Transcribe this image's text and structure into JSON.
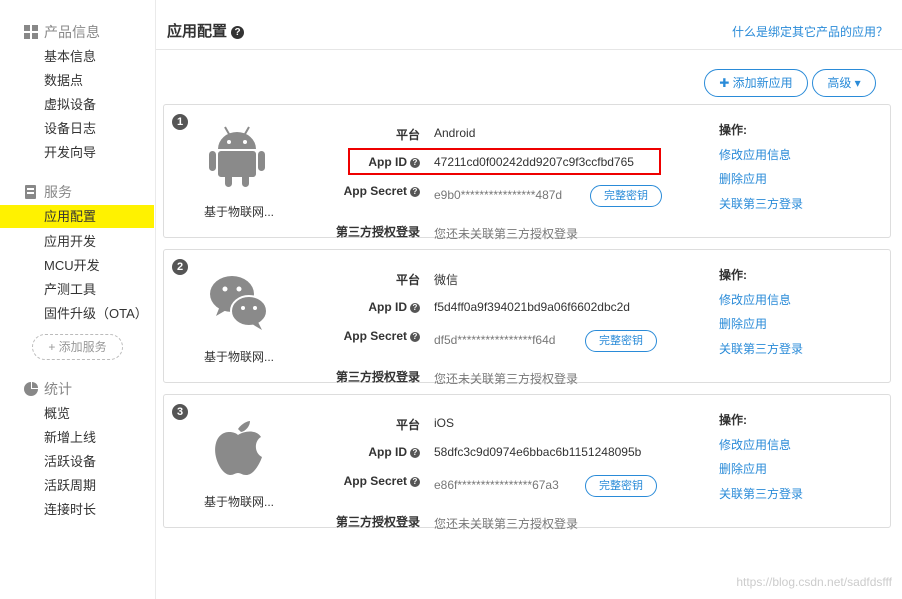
{
  "sidebar": {
    "product_info": {
      "title": "产品信息",
      "items": [
        "基本信息",
        "数据点",
        "虚拟设备",
        "设备日志",
        "开发向导"
      ]
    },
    "service": {
      "title": "服务",
      "items": [
        "应用配置",
        "应用开发",
        "MCU开发",
        "产测工具",
        "固件升级（OTA）"
      ],
      "active": "应用配置",
      "add_label": "+ 添加服务"
    },
    "stats": {
      "title": "统计",
      "items": [
        "概览",
        "新增上线",
        "活跃设备",
        "活跃周期",
        "连接时长"
      ]
    }
  },
  "header": {
    "title": "应用配置",
    "help_link": "什么是绑定其它产品的应用？"
  },
  "toolbar": {
    "add_app_label": "✚ 添加新应用",
    "advanced_label": "高级 ▾"
  },
  "labels": {
    "platform": "平台",
    "app_id": "App ID",
    "app_secret": "App Secret",
    "third_party": "第三方授权登录",
    "full_key": "完整密钥",
    "ops": "操作:",
    "op_edit": "修改应用信息",
    "op_delete": "删除应用",
    "op_link": "关联第三方登录"
  },
  "apps": [
    {
      "index": "1",
      "icon": "android-icon",
      "name": "基于物联网...",
      "platform": "Android",
      "app_id": "47211cd0f00242dd9207c9f3ccfbd765",
      "app_secret": "e9b0****************487d",
      "third_party": "您还未关联第三方授权登录"
    },
    {
      "index": "2",
      "icon": "wechat-icon",
      "name": "基于物联网...",
      "platform": "微信",
      "app_id": "f5d4ff0a9f394021bd9a06f6602dbc2d",
      "app_secret": "df5d****************f64d",
      "third_party": "您还未关联第三方授权登录"
    },
    {
      "index": "3",
      "icon": "apple-icon",
      "name": "基于物联网...",
      "platform": "iOS",
      "app_id": "58dfc3c9d0974e6bbac6b1151248095b",
      "app_secret": "e86f****************67a3",
      "third_party": "您还未关联第三方授权登录"
    }
  ],
  "watermark": "https://blog.csdn.net/sadfdsfff"
}
